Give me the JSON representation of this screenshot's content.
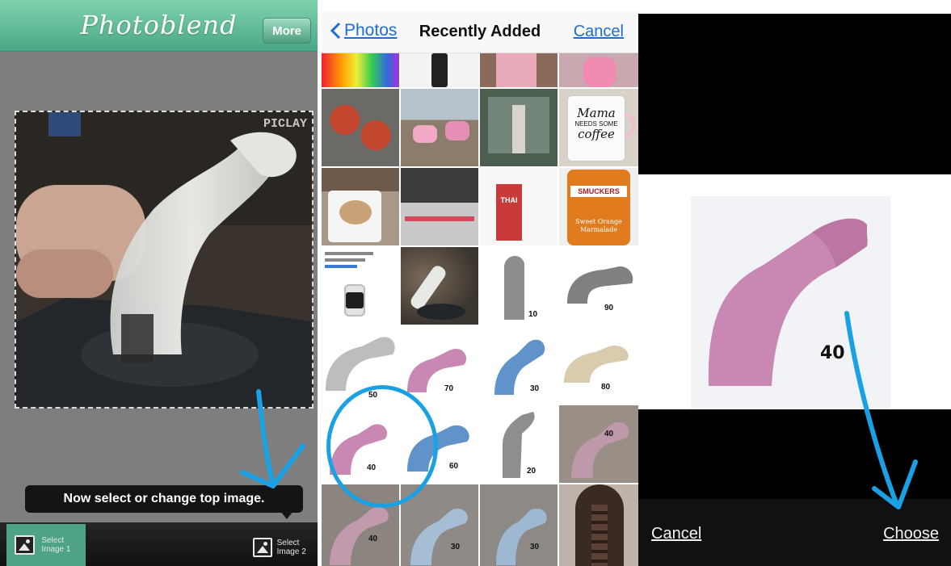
{
  "photoblend": {
    "app_title": "Photoblend",
    "more_label": "More",
    "watermark": "PICLAY",
    "toast": "Now select or change top image.",
    "select1_label": "Select Image 1",
    "select2_label": "Select Image 2"
  },
  "picker": {
    "back_label": "Photos",
    "title": "Recently Added",
    "cancel_label": "Cancel",
    "numbered_thumbs": [
      "10",
      "90",
      "50",
      "70",
      "30",
      "80",
      "40",
      "60",
      "20",
      "40",
      "40",
      "30",
      "30"
    ],
    "thumb_text": [
      "THAI",
      "SMUCKERS",
      "Sweet Orange Marmalade",
      "Mama",
      "NEEDS SOME",
      "coffee"
    ]
  },
  "preview": {
    "number_label": "40",
    "cancel_label": "Cancel",
    "choose_label": "Choose"
  },
  "colors": {
    "photoblend_green": "#4ea386",
    "ios_blue": "#1a6ed8",
    "annotation_blue": "#1aa1e4",
    "pink_model": "#c987b3",
    "blue_model": "#5f93c9"
  }
}
